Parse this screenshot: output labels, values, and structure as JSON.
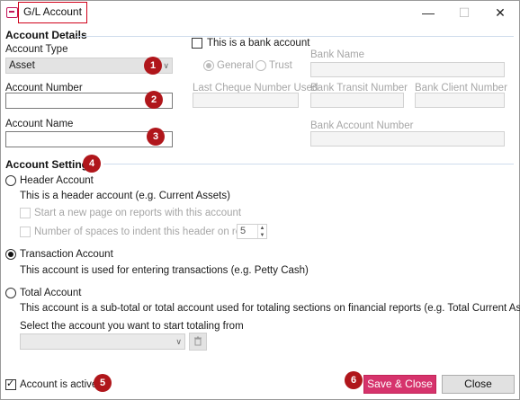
{
  "window": {
    "title": "G/L Account"
  },
  "badges": [
    "1",
    "2",
    "3",
    "4",
    "5",
    "6"
  ],
  "account_details": {
    "section_title": "Account Details",
    "account_type_label": "Account Type",
    "account_type_value": "Asset",
    "account_number_label": "Account Number",
    "account_number_value": "",
    "account_name_label": "Account Name",
    "account_name_value": "",
    "bank_checkbox_label": "This is a bank account",
    "bank_checked": false,
    "bank_type_general": "General",
    "bank_type_trust": "Trust",
    "bank_name_label": "Bank Name",
    "last_cheque_label": "Last Cheque Number Used",
    "bank_transit_label": "Bank Transit Number",
    "bank_client_label": "Bank Client Number",
    "bank_account_label": "Bank Account Number"
  },
  "account_settings": {
    "section_title": "Account Settings",
    "header_account_label": "Header Account",
    "header_account_desc": "This is a header account (e.g. Current Assets)",
    "new_page_label": "Start a new page on reports with this account",
    "indent_label": "Number of spaces to indent this header on reports",
    "indent_value": "5",
    "transaction_account_label": "Transaction Account",
    "transaction_account_desc": "This account is used for entering transactions (e.g. Petty Cash)",
    "total_account_label": "Total Account",
    "total_account_desc": "This account is a sub-total or total account used for totaling sections on financial reports (e.g. Total Current Assets)",
    "select_total_label": "Select the account you want to start totaling from",
    "selected_type": "Transaction Account"
  },
  "footer": {
    "active_label": "Account is active",
    "active_checked": true,
    "save_close_label": "Save & Close",
    "close_label": "Close"
  },
  "colors": {
    "badge": "#b0161b",
    "primary_button": "#d6336c",
    "section_rule": "#cfdcec"
  }
}
